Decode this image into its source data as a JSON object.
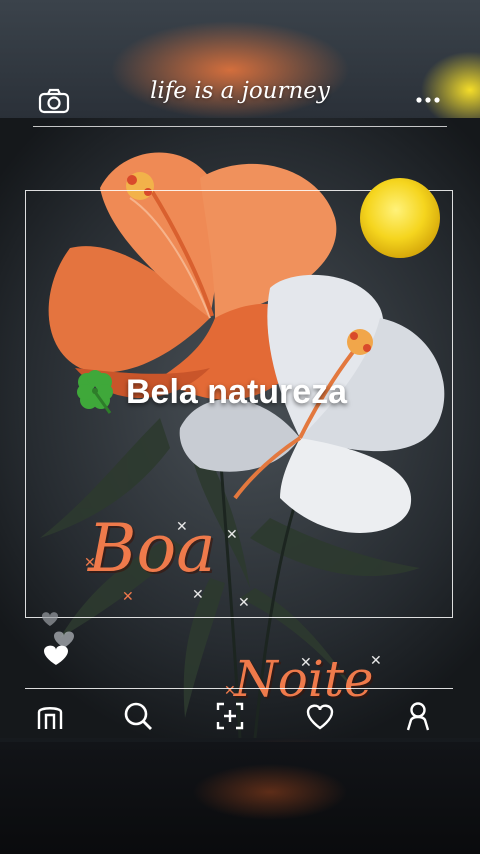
{
  "header": {
    "tagline": "life is a journey",
    "camera_icon": "camera-icon",
    "more_icon": "more-horizontal-icon"
  },
  "post": {
    "caption_icon": "four-leaf-clover-emoji",
    "caption": "Bela natureza",
    "greeting_line1": "Boa",
    "greeting_line2": "Noite"
  },
  "nav": {
    "items": [
      {
        "icon": "home-icon"
      },
      {
        "icon": "search-icon"
      },
      {
        "icon": "add-post-icon"
      },
      {
        "icon": "heart-icon"
      },
      {
        "icon": "profile-icon"
      }
    ]
  },
  "colors": {
    "accent_orange": "#ef7a4b",
    "moon_yellow": "#f5d51e",
    "flower_white": "#e6e9ee"
  }
}
